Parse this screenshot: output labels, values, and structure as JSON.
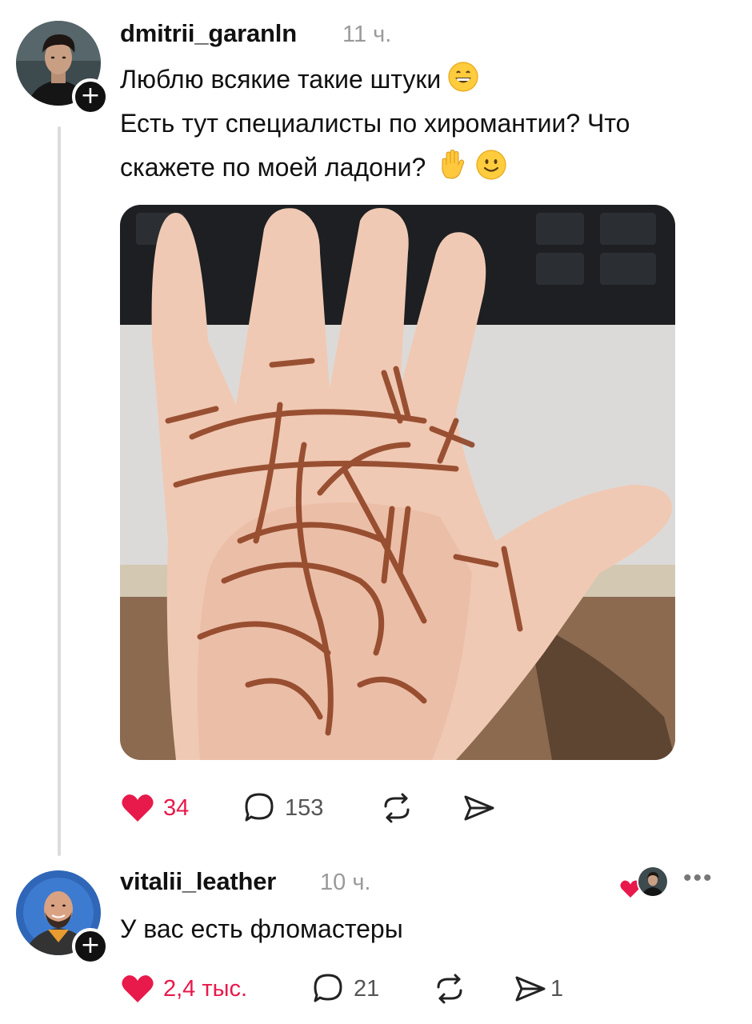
{
  "post": {
    "username": "dmitrii_garanln",
    "timestamp": "11 ч.",
    "text_lines": [
      "Люблю всякие такие штуки",
      "Есть тут специалисты по хиромантии? Что",
      "скажете по моей ладони?"
    ],
    "emojis": [
      "grinning-face",
      "raised-hand",
      "slightly-smiling-face"
    ],
    "image_subject": "palm-drawn-lines-photo",
    "actions": {
      "likes": "34",
      "comments": "153",
      "repost_icon": "repost-icon",
      "share_icon": "share-icon"
    }
  },
  "reply": {
    "username": "vitalii_leather",
    "timestamp": "10 ч.",
    "text": "У вас есть фломастеры",
    "actions": {
      "likes": "2,4 тыс.",
      "comments": "21",
      "shares": "1"
    }
  },
  "follow_badge_symbol": "+",
  "more_menu_symbol": "•••",
  "colors": {
    "like_red": "#e8194b",
    "muted_gray": "#9a9a9a",
    "thread_line": "#dcdcdc"
  }
}
